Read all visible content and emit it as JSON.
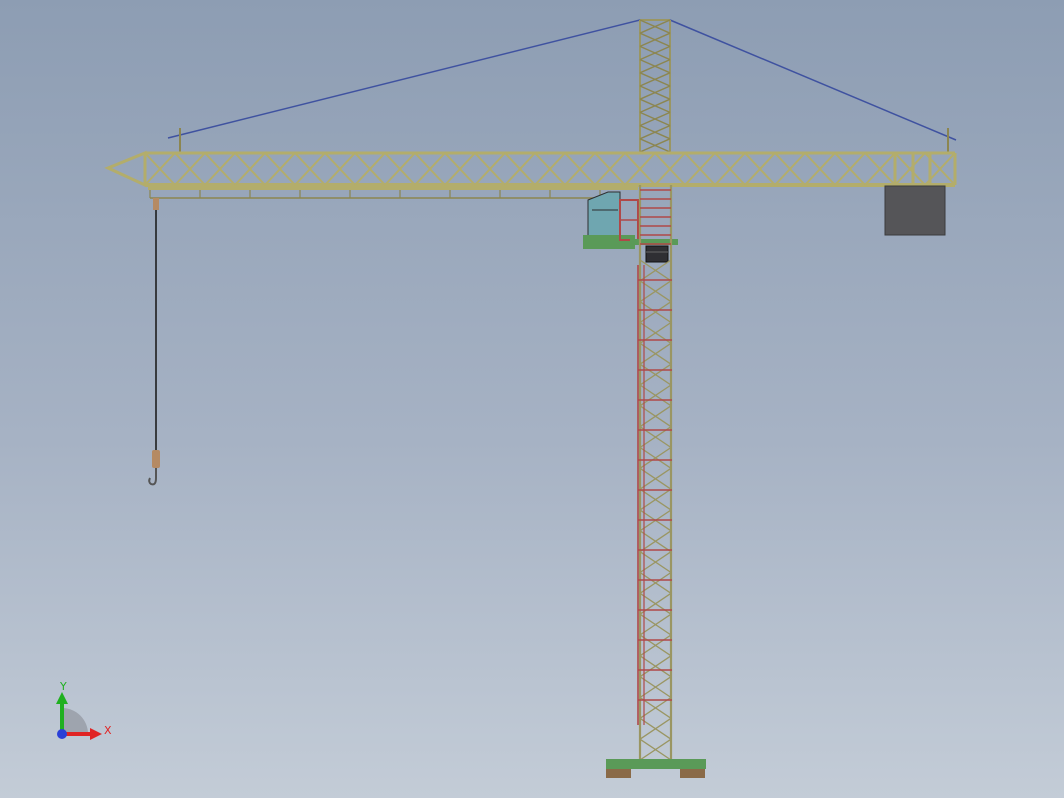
{
  "colors": {
    "background_top": "#8d9db3",
    "background_bottom": "#c3ccd7",
    "jib_truss": "#b3ad6b",
    "jib_truss_dark": "#8c8650",
    "mast_lattice": "#9a9662",
    "ladder_red": "#b04848",
    "tie_cable": "#3f52a0",
    "counterweight": "#555558",
    "platform_green": "#5a9a58",
    "cab_teal": "#6fa6b0",
    "base_brown": "#8a6a48",
    "hoist_cable": "#1e1e1e",
    "hook": "#b58a63",
    "axis_x": "#e02424",
    "axis_y": "#20b020",
    "axis_z": "#2a40d8"
  },
  "icons": {
    "triad": "xyz-triad-icon"
  },
  "triad": {
    "x_label": "X",
    "y_label": "Y"
  }
}
